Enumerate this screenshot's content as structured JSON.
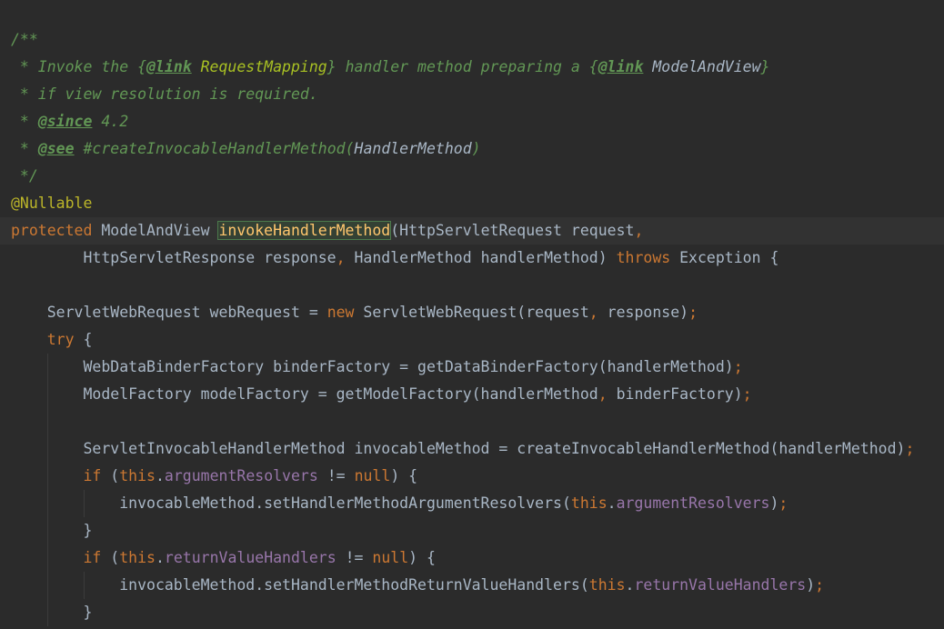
{
  "colors": {
    "background": "#2b2b2b",
    "current_line": "#323232",
    "doc_comment": "#629755",
    "link_reference": "#a8c023",
    "annotation": "#bbb529",
    "keyword": "#cc7832",
    "field": "#9876aa",
    "plain": "#a9b7c6",
    "method_declaration": "#ffc66d",
    "highlight_bg": "#344134"
  },
  "code": {
    "l1": {
      "a": "/**"
    },
    "l2": {
      "a": " * Invoke the ",
      "b": "{",
      "c": "@link",
      "d": " RequestMapping",
      "e": "}",
      "f": " handler method preparing a ",
      "g": "{",
      "h": "@link",
      "i": " ModelAndView",
      "j": "}"
    },
    "l3": {
      "a": " * if view resolution is required."
    },
    "l4": {
      "a": " * ",
      "b": "@since",
      "c": " 4.2"
    },
    "l5": {
      "a": " * ",
      "b": "@see",
      "c": " #createInvocableHandlerMethod(",
      "d": "HandlerMethod",
      "e": ")"
    },
    "l6": {
      "a": " */"
    },
    "l7": {
      "a": "@Nullable"
    },
    "l8": {
      "a": "protected",
      "b": " ModelAndView ",
      "c": "invokeHandlerMethod",
      "d": "(HttpServletRequest request",
      "e": ","
    },
    "l9": {
      "a": "        HttpServletResponse response",
      "b": ",",
      "c": " HandlerMethod handlerMethod) ",
      "d": "throws",
      "e": " Exception {"
    },
    "l10": {
      "a": ""
    },
    "l11": {
      "a": "    ServletWebRequest webRequest = ",
      "b": "new",
      "c": " ServletWebRequest(request",
      "d": ",",
      "e": " response)",
      "f": ";"
    },
    "l12": {
      "a": "    ",
      "b": "try",
      "c": " {"
    },
    "l13": {
      "a": "        WebDataBinderFactory binderFactory = getDataBinderFactory(handlerMethod)",
      "b": ";"
    },
    "l14": {
      "a": "        ModelFactory modelFactory = getModelFactory(handlerMethod",
      "b": ",",
      "c": " binderFactory)",
      "d": ";"
    },
    "l15": {
      "a": ""
    },
    "l16": {
      "a": "        ServletInvocableHandlerMethod invocableMethod = createInvocableHandlerMethod(handlerMethod)",
      "b": ";"
    },
    "l17": {
      "a": "        ",
      "b": "if",
      "c": " (",
      "d": "this",
      "e": ".",
      "f": "argumentResolvers",
      "g": " != ",
      "h": "null",
      "i": ") {"
    },
    "l18": {
      "a": "            invocableMethod.setHandlerMethodArgumentResolvers(",
      "b": "this",
      "c": ".",
      "d": "argumentResolvers",
      "e": ")",
      "f": ";"
    },
    "l19": {
      "a": "        }"
    },
    "l20": {
      "a": "        ",
      "b": "if",
      "c": " (",
      "d": "this",
      "e": ".",
      "f": "returnValueHandlers",
      "g": " != ",
      "h": "null",
      "i": ") {"
    },
    "l21": {
      "a": "            invocableMethod.setHandlerMethodReturnValueHandlers(",
      "b": "this",
      "c": ".",
      "d": "returnValueHandlers",
      "e": ")",
      "f": ";"
    },
    "l22": {
      "a": "        }"
    }
  }
}
